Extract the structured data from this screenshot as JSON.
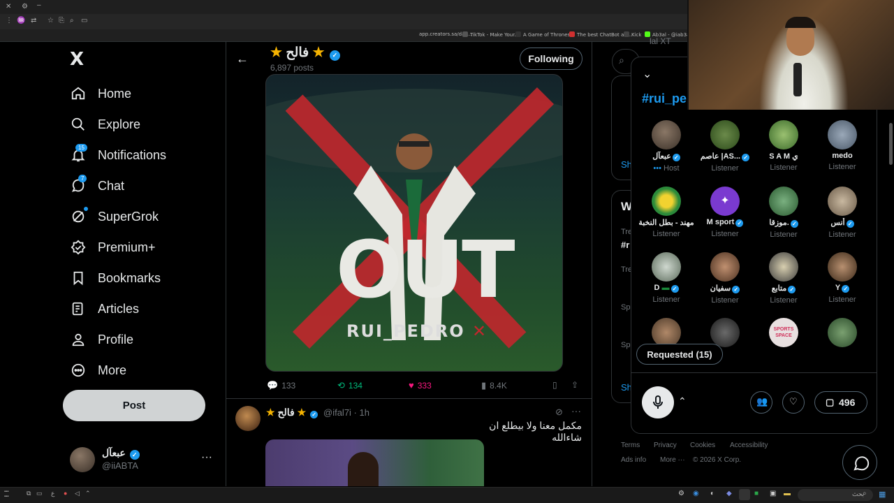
{
  "browser": {
    "bookmarks": [
      {
        "label": "app.creators.sa/das..."
      },
      {
        "label": "TikTok - Make Your..."
      },
      {
        "label": "A Game of Thrones..."
      },
      {
        "label": "The best ChatBot an..."
      },
      {
        "label": "Kick"
      },
      {
        "label": "Ab3al - @iab3al"
      }
    ]
  },
  "sidebar": {
    "logo": "X",
    "items": [
      {
        "label": "Home",
        "icon": "home-icon"
      },
      {
        "label": "Explore",
        "icon": "search-icon"
      },
      {
        "label": "Notifications",
        "icon": "bell-icon",
        "badge": "15"
      },
      {
        "label": "Chat",
        "icon": "chat-icon",
        "badge": "7"
      },
      {
        "label": "SuperGrok",
        "icon": "grok-icon"
      },
      {
        "label": "Premium+",
        "icon": "premium-icon"
      },
      {
        "label": "Bookmarks",
        "icon": "bookmark-icon"
      },
      {
        "label": "Articles",
        "icon": "articles-icon"
      },
      {
        "label": "Profile",
        "icon": "profile-icon"
      },
      {
        "label": "More",
        "icon": "more-icon"
      }
    ],
    "post_label": "Post",
    "account": {
      "name": "عبعآل",
      "handle": "@iiABTA"
    }
  },
  "profile_header": {
    "name": "فالح",
    "posts": "6,897 posts",
    "follow_label": "Following"
  },
  "tweet1": {
    "image_text": "OUT",
    "image_caption": "RUI_PEDRO",
    "replies": "133",
    "retweets": "134",
    "likes": "333",
    "views": "8.4K"
  },
  "tweet2": {
    "name": "فالح",
    "handle": "@ifal7i · 1h",
    "text": "مكمل معنا ولا بيطلع ان شاءالله"
  },
  "spaces": {
    "title": "#rui_pe",
    "requested_label": "Requested (15)",
    "comments_count": "496",
    "participants": [
      {
        "name": "عبعآل",
        "role": "Host",
        "verified": true
      },
      {
        "name": "عاصم |AS...",
        "role": "Listener",
        "verified": true
      },
      {
        "name": "S A M ي",
        "role": "Listener",
        "verified": false
      },
      {
        "name": "medo",
        "role": "Listener",
        "verified": false
      },
      {
        "name": "مهند - بطل النخبة",
        "role": "Listener",
        "verified": false
      },
      {
        "name": "M sport",
        "role": "Listener",
        "verified": true
      },
      {
        "name": "موزقا.",
        "role": "Listener",
        "verified": true
      },
      {
        "name": "أنس",
        "role": "Listener",
        "verified": true
      },
      {
        "name": "D",
        "role": "Listener",
        "verified": true
      },
      {
        "name": "سفيان",
        "role": "Listener",
        "verified": true
      },
      {
        "name": "متابع",
        "role": "Listener",
        "verified": true
      },
      {
        "name": "Y",
        "role": "Listener",
        "verified": true
      },
      {
        "name": "",
        "role": "",
        "verified": false
      },
      {
        "name": "",
        "role": "",
        "verified": false
      },
      {
        "name": "SPORTS SPACE",
        "role": "",
        "verified": false
      },
      {
        "name": "",
        "role": "",
        "verified": false
      }
    ]
  },
  "right_column": {
    "partial_header": "lal XT",
    "partial_w": "W",
    "partial_tre": "Tre",
    "partial_hash": "#r",
    "partial_show": "Sh",
    "partial_spe": "Spe"
  },
  "footer": {
    "links": [
      "Terms",
      "Privacy",
      "Cookies",
      "Accessibility",
      "Ads info",
      "More ···",
      "© 2026 X Corp."
    ]
  },
  "taskbar": {
    "search_placeholder": "بحث"
  },
  "colors": {
    "accent": "#1d9bf0",
    "retweet": "#00ba7c",
    "like": "#f91880"
  }
}
